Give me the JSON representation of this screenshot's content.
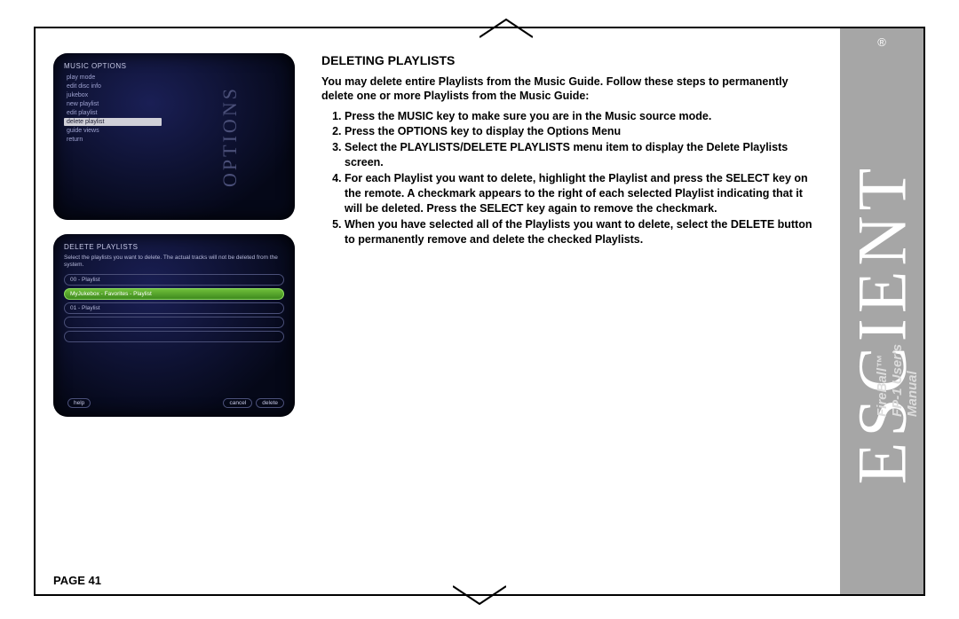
{
  "page_label": "PAGE 41",
  "brand": {
    "name": "ESCIENT",
    "registered": "®",
    "manual_line": "FireBall™ FP-1 User's Manual"
  },
  "section": {
    "title": "DELETING PLAYLISTS",
    "intro": "You may delete entire Playlists from the Music Guide. Follow these steps to permanently delete one or more Playlists from the Music Guide:",
    "steps": [
      "Press the MUSIC key to make sure you are in the Music source mode.",
      "Press the OPTIONS key to display the Options Menu",
      "Select the PLAYLISTS/DELETE PLAYLISTS menu item to display the Delete Playlists screen.",
      "For each Playlist you want to delete, highlight the Playlist and press the SELECT key on the remote. A checkmark appears to the right of each selected Playlist indicating that it will be deleted. Press the SELECT key again to remove the checkmark.",
      "When you have selected all of the Playlists you want to delete, select the DELETE button to permanently remove and delete the checked Playlists."
    ]
  },
  "screen_options": {
    "header": "MUSIC OPTIONS",
    "side_label": "OPTIONS",
    "items": [
      {
        "label": "play mode",
        "hl": false
      },
      {
        "label": "edit disc info",
        "hl": false
      },
      {
        "label": "jukebox",
        "hl": false
      },
      {
        "label": "new playlist",
        "hl": false
      },
      {
        "label": "edit playlist",
        "hl": false
      },
      {
        "label": "delete playlist",
        "hl": true
      },
      {
        "label": "guide views",
        "hl": false
      },
      {
        "label": "return",
        "hl": false
      }
    ]
  },
  "screen_delete": {
    "header": "DELETE PLAYLISTS",
    "sub": "Select the playlists you want to delete. The actual tracks will not be deleted from the system.",
    "rows": [
      {
        "label": "00 - Playlist",
        "sel": false
      },
      {
        "label": "MyJukebox - Favorites - Playlist",
        "sel": true
      },
      {
        "label": "01 - Playlist",
        "sel": false
      },
      {
        "label": "",
        "sel": false
      },
      {
        "label": "",
        "sel": false
      }
    ],
    "buttons": {
      "help": "help",
      "cancel": "cancel",
      "delete": "delete"
    }
  }
}
